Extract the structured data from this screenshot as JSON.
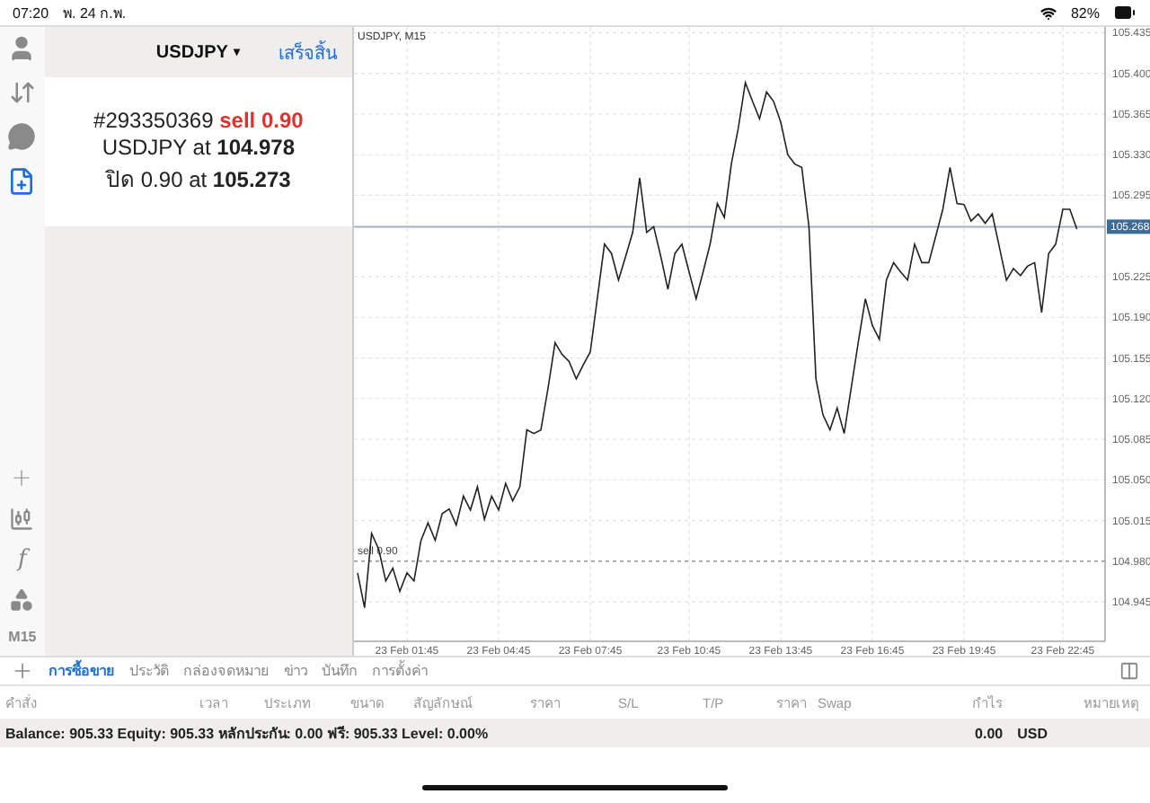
{
  "status_bar": {
    "time": "07:20",
    "date": "พ. 24 ก.พ.",
    "battery": "82%"
  },
  "toolbar": {
    "top_icons": [
      {
        "kind": "account",
        "selected": false
      },
      {
        "kind": "trade",
        "selected": false
      },
      {
        "kind": "chat",
        "selected": false
      },
      {
        "kind": "new-order",
        "selected": true
      }
    ],
    "bottom_icons": [
      {
        "kind": "crosshair"
      },
      {
        "kind": "candles"
      },
      {
        "kind": "indicator",
        "glyph": "f"
      },
      {
        "kind": "objects"
      }
    ],
    "timeframe": "M15"
  },
  "order_panel": {
    "symbol": "USDJPY",
    "dropdown": "▾",
    "done": "เสร็จสิ้น",
    "ticket": "#293350369",
    "side": "sell 0.90",
    "detail_lines": [
      "USDJPY at **104.978**",
      "ปิด 0.90 at **105.273**"
    ]
  },
  "chart": {
    "title": "USDJPY, M15",
    "chart_data": {
      "type": "line",
      "grid": true,
      "ylim": [
        104.911,
        105.44
      ],
      "categories": [
        null,
        null,
        null,
        null,
        null,
        null,
        null,
        "23 Feb 01:45",
        null,
        null,
        null,
        null,
        null,
        null,
        null,
        null,
        null,
        null,
        null,
        null,
        "23 Feb 04:45",
        null,
        null,
        null,
        null,
        null,
        null,
        null,
        null,
        null,
        null,
        null,
        null,
        "23 Feb 07:45",
        null,
        null,
        null,
        null,
        null,
        null,
        null,
        null,
        null,
        null,
        null,
        null,
        null,
        "23 Feb 10:45",
        null,
        null,
        null,
        null,
        null,
        null,
        null,
        null,
        null,
        null,
        null,
        null,
        "23 Feb 13:45",
        null,
        null,
        null,
        null,
        null,
        null,
        null,
        null,
        null,
        null,
        null,
        null,
        "23 Feb 16:45",
        null,
        null,
        null,
        null,
        null,
        null,
        null,
        null,
        null,
        null,
        null,
        null,
        "23 Feb 19:45",
        null,
        null,
        null,
        null,
        null,
        null,
        null,
        null,
        null,
        null,
        null,
        null,
        null,
        "23 Feb 22:45",
        null,
        null
      ],
      "yticks": [
        {
          "value": 105.435,
          "label": "105.435"
        },
        {
          "value": 105.4,
          "label": "105.400"
        },
        {
          "value": 105.365,
          "label": "105.365"
        },
        {
          "value": 105.33,
          "label": "105.330"
        },
        {
          "value": 105.295,
          "label": "105.295"
        },
        {
          "value": 105.225,
          "label": "105.225"
        },
        {
          "value": 105.19,
          "label": "105.190"
        },
        {
          "value": 105.155,
          "label": "105.155"
        },
        {
          "value": 105.12,
          "label": "105.120"
        },
        {
          "value": 105.085,
          "label": "105.085"
        },
        {
          "value": 105.05,
          "label": "105.050"
        },
        {
          "value": 105.015,
          "label": "105.015"
        },
        {
          "value": 104.98,
          "label": "104.980"
        },
        {
          "value": 104.945,
          "label": "104.945"
        }
      ],
      "series": [
        {
          "color": "#222222",
          "values": [
            104.97,
            104.94,
            105.004,
            104.99,
            104.963,
            104.974,
            104.954,
            104.97,
            104.963,
            104.998,
            105.013,
            104.998,
            105.021,
            105.025,
            105.011,
            105.036,
            105.024,
            105.044,
            105.016,
            105.036,
            105.024,
            105.047,
            105.032,
            105.044,
            105.093,
            105.09,
            105.093,
            105.129,
            105.168,
            105.158,
            105.152,
            105.137,
            105.149,
            105.16,
            105.206,
            105.253,
            105.245,
            105.222,
            105.242,
            105.263,
            105.31,
            105.263,
            105.268,
            105.242,
            105.214,
            105.245,
            105.253,
            105.229,
            105.206,
            105.229,
            105.253,
            105.288,
            105.276,
            105.322,
            105.353,
            105.392,
            105.376,
            105.361,
            105.384,
            105.376,
            105.358,
            105.33,
            105.322,
            105.319,
            105.268,
            105.137,
            105.106,
            105.093,
            105.112,
            105.09,
            105.129,
            105.168,
            105.206,
            105.183,
            105.171,
            105.222,
            105.237,
            105.229,
            105.222,
            105.253,
            105.237,
            105.237,
            105.26,
            105.283,
            105.319,
            105.288,
            105.287,
            105.273,
            105.279,
            105.271,
            105.279,
            105.251,
            105.222,
            105.232,
            105.226,
            105.234,
            105.237,
            105.194,
            105.245,
            105.253,
            105.283,
            105.283,
            105.266
          ]
        }
      ],
      "ref_lines": [
        {
          "axis": "y",
          "value": 105.268,
          "label": "105.268",
          "color": "#9db4cb"
        },
        {
          "axis": "y",
          "value": 104.98,
          "label": "sell 0.90",
          "color": "#999999"
        }
      ]
    }
  },
  "bottom_tabs": [
    {
      "label": "การซื้อขาย",
      "selected": true
    },
    {
      "label": "ประวัติ",
      "selected": false
    },
    {
      "label": "กล่องจดหมาย",
      "selected": false
    },
    {
      "label": "ข่าว",
      "selected": false
    },
    {
      "label": "บันทึก",
      "selected": false
    },
    {
      "label": "การตั้งค่า",
      "selected": false
    }
  ],
  "table": {
    "columns": [
      "คำสั่ง",
      "เวลา",
      "ประเภท",
      "ขนาด",
      "สัญลักษณ์",
      "ราคา",
      "S/L",
      "T/P",
      "ราคา",
      "Swap",
      "กำไร",
      "หมายเหตุ"
    ]
  },
  "summary": {
    "text": "Balance: 905.33 Equity: 905.33 หลักประกัน: 0.00 ฟรี: 905.33 Level: 0.00%",
    "profit": "0.00",
    "currency": "USD"
  }
}
